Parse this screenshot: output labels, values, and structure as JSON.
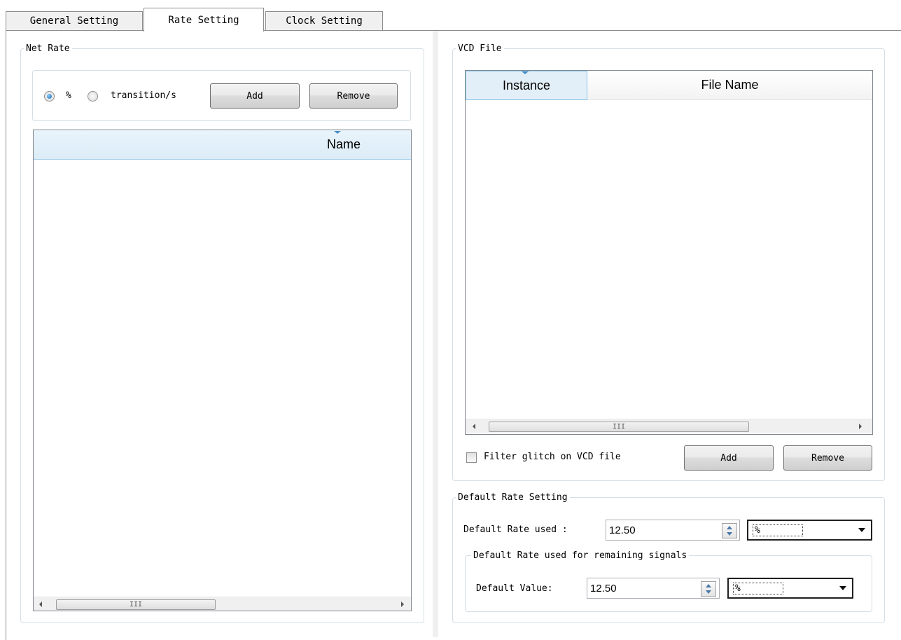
{
  "tabs": [
    "General Setting",
    "Rate Setting",
    "Clock Setting"
  ],
  "net_rate": {
    "legend": "Net Rate",
    "radio_percent": "%",
    "radio_transitions": "transition/s",
    "add": "Add",
    "remove": "Remove",
    "column_name": "Name",
    "scroll_thumb": "III"
  },
  "vcd_file": {
    "legend": "VCD File",
    "col_instance": "Instance",
    "col_file_name": "File Name",
    "scroll_thumb": "III",
    "filter_label": "Filter glitch on VCD file",
    "add": "Add",
    "remove": "Remove"
  },
  "default_rate": {
    "legend": "Default Rate Setting",
    "used_label": "Default Rate used :",
    "used_value": "12.50",
    "used_unit": "%",
    "remaining_legend": "Default Rate used for remaining signals",
    "value_label": "Default Value:",
    "value": "12.50",
    "value_unit": "%"
  }
}
